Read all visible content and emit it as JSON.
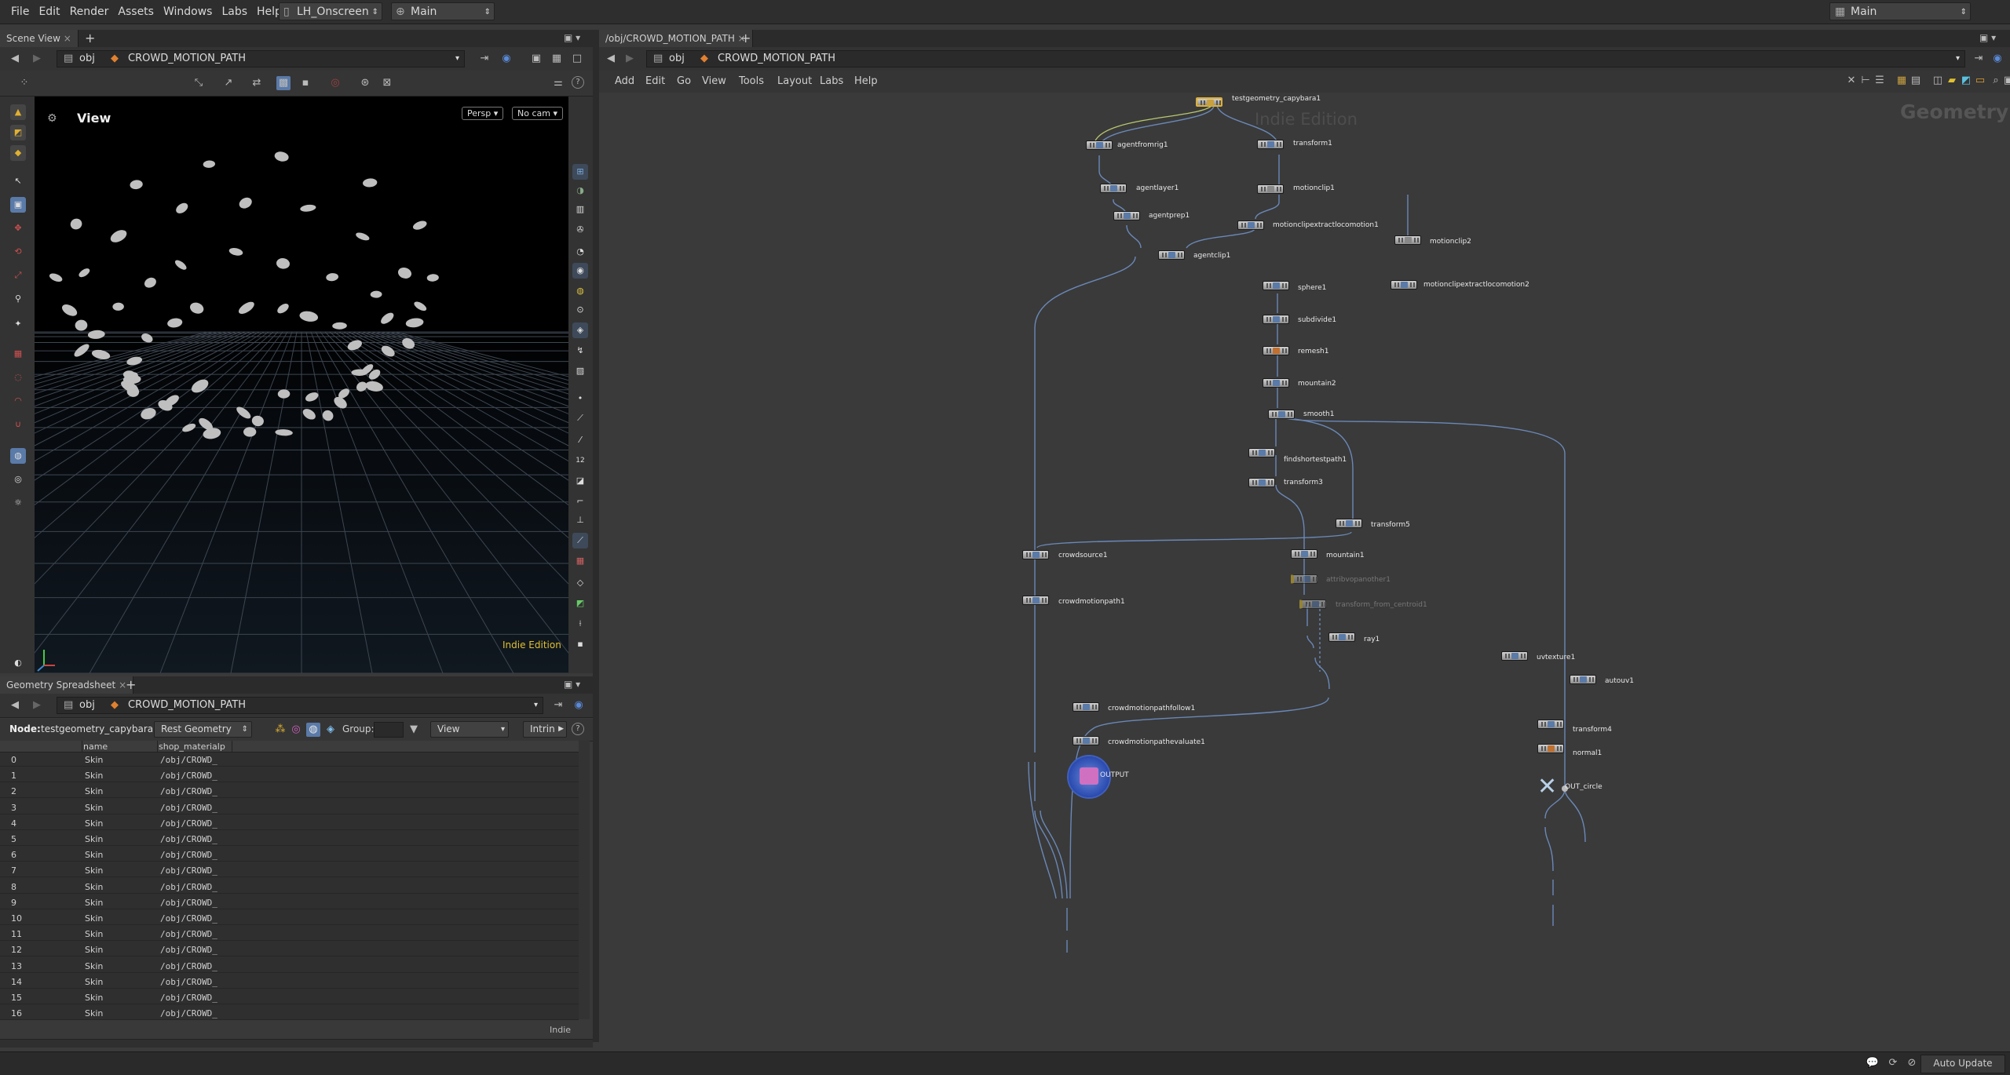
{
  "menubar": {
    "items": [
      "File",
      "Edit",
      "Render",
      "Assets",
      "Windows",
      "Labs",
      "Help"
    ],
    "desktop_combo": "LH_Onscreen",
    "context_combo": "Main",
    "right_combo": "Main"
  },
  "scene_view": {
    "tab_label": "Scene View",
    "path_root": "obj",
    "path_node": "CROWD_MOTION_PATH",
    "viewport_title": "View",
    "persp_btn": "Persp",
    "cam_btn": "No cam",
    "watermark": "Indie Edition"
  },
  "spreadsheet": {
    "tab_label": "Geometry Spreadsheet",
    "path_root": "obj",
    "path_node": "CROWD_MOTION_PATH",
    "node_label": "Node:",
    "node_value": "testgeometry_capybara1",
    "mode_combo": "Rest Geometry",
    "group_label": "Group:",
    "view_combo": "View",
    "intrinsics_combo": "Intrin",
    "columns": [
      "name",
      "shop_materialp"
    ],
    "rows": [
      {
        "idx": "0",
        "name": "Skin",
        "mat": "/obj/CROWD_"
      },
      {
        "idx": "1",
        "name": "Skin",
        "mat": "/obj/CROWD_"
      },
      {
        "idx": "2",
        "name": "Skin",
        "mat": "/obj/CROWD_"
      },
      {
        "idx": "3",
        "name": "Skin",
        "mat": "/obj/CROWD_"
      },
      {
        "idx": "4",
        "name": "Skin",
        "mat": "/obj/CROWD_"
      },
      {
        "idx": "5",
        "name": "Skin",
        "mat": "/obj/CROWD_"
      },
      {
        "idx": "6",
        "name": "Skin",
        "mat": "/obj/CROWD_"
      },
      {
        "idx": "7",
        "name": "Skin",
        "mat": "/obj/CROWD_"
      },
      {
        "idx": "8",
        "name": "Skin",
        "mat": "/obj/CROWD_"
      },
      {
        "idx": "9",
        "name": "Skin",
        "mat": "/obj/CROWD_"
      },
      {
        "idx": "10",
        "name": "Skin",
        "mat": "/obj/CROWD_"
      },
      {
        "idx": "11",
        "name": "Skin",
        "mat": "/obj/CROWD_"
      },
      {
        "idx": "12",
        "name": "Skin",
        "mat": "/obj/CROWD_"
      },
      {
        "idx": "13",
        "name": "Skin",
        "mat": "/obj/CROWD_"
      },
      {
        "idx": "14",
        "name": "Skin",
        "mat": "/obj/CROWD_"
      },
      {
        "idx": "15",
        "name": "Skin",
        "mat": "/obj/CROWD_"
      },
      {
        "idx": "16",
        "name": "Skin",
        "mat": "/obj/CROWD_"
      }
    ],
    "footer": "Indie"
  },
  "network": {
    "tab_label": "/obj/CROWD_MOTION_PATH",
    "path_root": "obj",
    "path_node": "CROWD_MOTION_PATH",
    "menu": [
      "Add",
      "Edit",
      "Go",
      "View",
      "Tools",
      "Layout",
      "Labs",
      "Help"
    ],
    "watermark": "Indie Edition",
    "context_label": "Geometry",
    "nodes": {
      "testgeometry_capybara1": "testgeometry_capybara1",
      "agentfromrig1": "agentfromrig1",
      "transform1": "transform1",
      "agentlayer1": "agentlayer1",
      "motionclip1": "motionclip1",
      "motionclip2": "motionclip2",
      "agentprep1": "agentprep1",
      "motionclipextractlocomotion1": "motionclipextractlocomotion1",
      "motionclipextractlocomotion2": "motionclipextractlocomotion2",
      "agentclip1": "agentclip1",
      "sphere1": "sphere1",
      "subdivide1": "subdivide1",
      "remesh1": "remesh1",
      "mountain2": "mountain2",
      "smooth1": "smooth1",
      "findshortestpath1": "findshortestpath1",
      "transform3": "transform3",
      "transform5": "transform5",
      "crowdsource1": "crowdsource1",
      "mountain1": "mountain1",
      "attribvopanother": "attribvopanother1",
      "transform_from_centroid": "transform_from_centroid1",
      "ray1": "ray1",
      "crowdmotionpath1": "crowdmotionpath1",
      "uvtexture1": "uvtexture1",
      "autouv1": "autouv1",
      "crowdmotionpathfollow1": "crowdmotionpathfollow1",
      "transform4": "transform4",
      "crowdmotionpathevaluate1": "crowdmotionpathevaluate1",
      "normal1": "normal1",
      "OUTPUT": "OUTPUT",
      "OUT_circle": "OUT_circle"
    }
  },
  "statusbar": {
    "auto_update": "Auto Update"
  },
  "colors": {
    "accent_yellow": "#e0b030",
    "wire_blue": "#6a88b8",
    "output_blue": "#3a5fb8"
  }
}
